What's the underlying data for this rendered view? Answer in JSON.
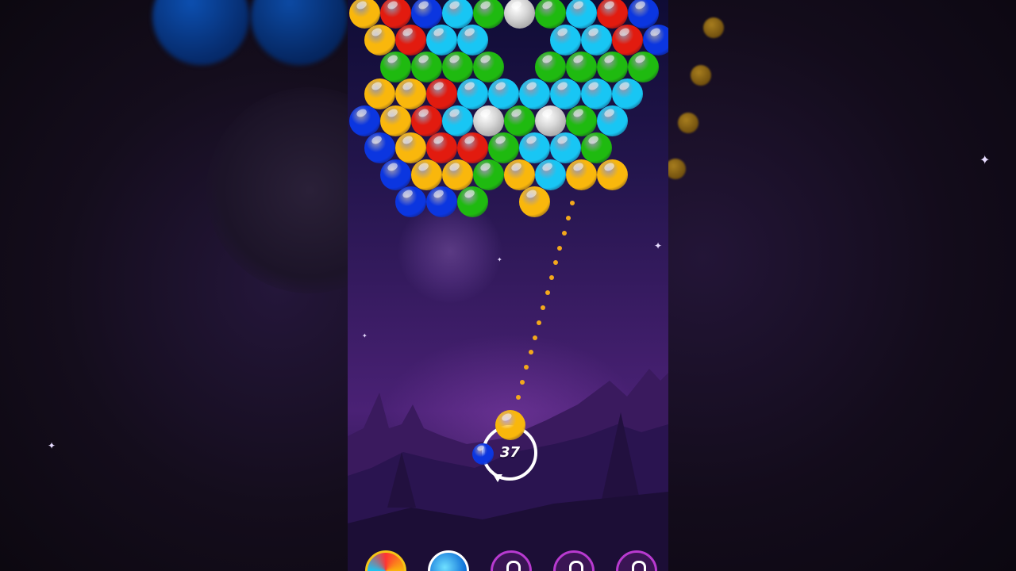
{
  "game": {
    "shots_remaining": "37",
    "bubble_colors": {
      "yellow": "#f9b70c",
      "red": "#e21b0f",
      "blue": "#0b36e0",
      "cyan": "#18c6f4",
      "green": "#1fba10",
      "stone": "#c9c9c9"
    },
    "bubble_rows": [
      [
        "yellow",
        "red",
        "blue",
        "cyan",
        "green",
        "stone",
        "green",
        "cyan",
        "red",
        "blue"
      ],
      [
        "yellow",
        "red",
        "cyan",
        "cyan",
        "",
        "",
        "cyan",
        "cyan",
        "red",
        "blue"
      ],
      [
        "green",
        "green",
        "green",
        "green",
        "",
        "green",
        "green",
        "green",
        "green"
      ],
      [
        "yellow",
        "yellow",
        "red",
        "cyan",
        "cyan",
        "cyan",
        "cyan",
        "cyan",
        "cyan"
      ],
      [
        "blue",
        "yellow",
        "red",
        "cyan",
        "stone",
        "green",
        "stone",
        "green",
        "cyan"
      ],
      [
        "blue",
        "yellow",
        "red",
        "red",
        "green",
        "cyan",
        "cyan",
        "green"
      ],
      [
        "blue",
        "yellow",
        "yellow",
        "green",
        "yellow",
        "cyan",
        "yellow",
        "yellow"
      ],
      [
        "blue",
        "blue",
        "green",
        "",
        "yellow"
      ]
    ],
    "loaded_bubble": "yellow",
    "next_bubble": "blue",
    "boosters": [
      {
        "name": "rainbow-booster",
        "state": "available"
      },
      {
        "name": "lightning-booster",
        "state": "available"
      },
      {
        "name": "locked-booster",
        "state": "locked"
      },
      {
        "name": "locked-booster",
        "state": "locked"
      },
      {
        "name": "locked-booster",
        "state": "locked"
      }
    ]
  }
}
